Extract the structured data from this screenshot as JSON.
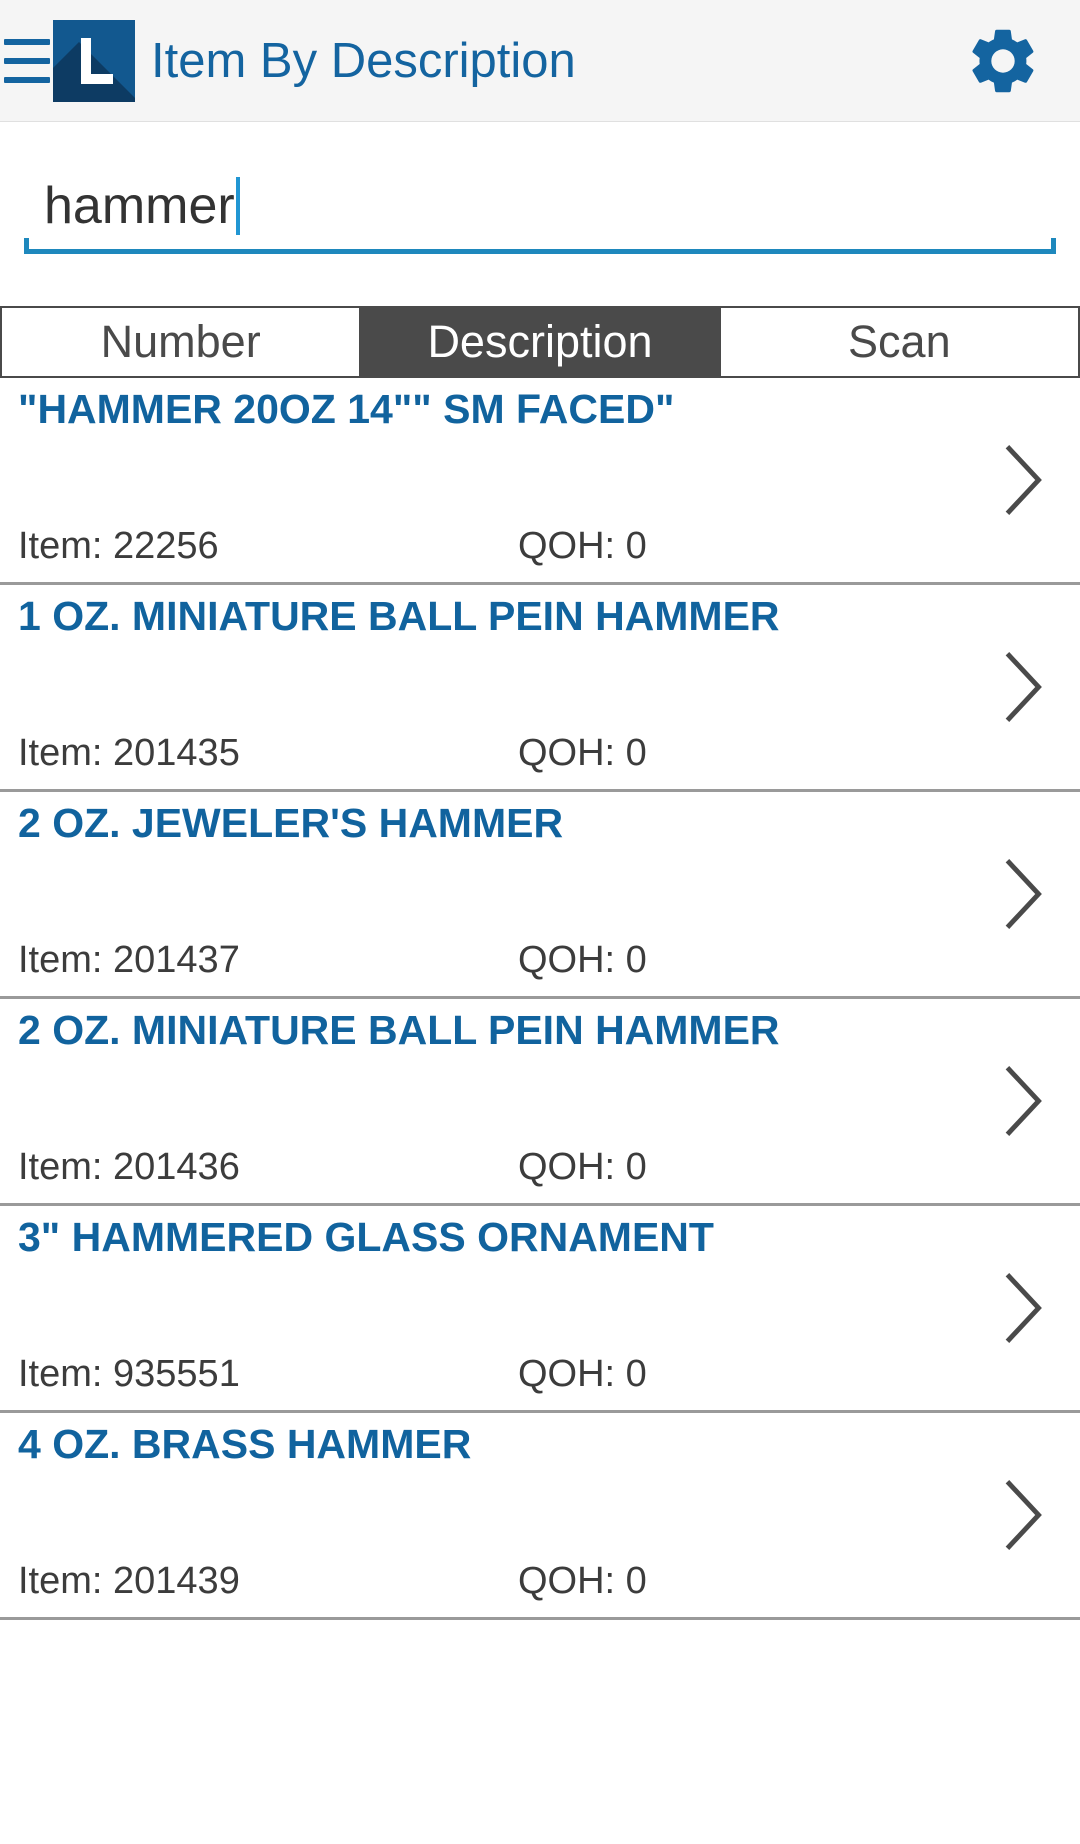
{
  "header": {
    "menu_icon": "hamburger-menu-icon",
    "logo_letter": "L",
    "title": "Item By Description",
    "settings_icon": "gear-icon",
    "accent_color": "#1464a0"
  },
  "search": {
    "value": "hammer",
    "placeholder": ""
  },
  "tabs": [
    {
      "label": "Number",
      "active": false
    },
    {
      "label": "Description",
      "active": true
    },
    {
      "label": "Scan",
      "active": false
    }
  ],
  "list": {
    "item_label": "Item:",
    "qoh_label": "QOH:",
    "chevron_icon": "chevron-right-icon",
    "rows": [
      {
        "title": "\"HAMMER 20OZ  14\"\" SM FACED\"",
        "item": "Item: 22256",
        "qoh": "QOH: 0"
      },
      {
        "title": "1 OZ. MINIATURE BALL PEIN HAMMER",
        "item": "Item: 201435",
        "qoh": "QOH: 0"
      },
      {
        "title": "2 OZ. JEWELER'S HAMMER",
        "item": "Item: 201437",
        "qoh": "QOH: 0"
      },
      {
        "title": "2 OZ. MINIATURE BALL PEIN HAMMER",
        "item": "Item: 201436",
        "qoh": "QOH: 0"
      },
      {
        "title": "3\" HAMMERED GLASS ORNAMENT",
        "item": "Item: 935551",
        "qoh": "QOH: 0"
      },
      {
        "title": "4 OZ. BRASS HAMMER",
        "item": "Item: 201439",
        "qoh": "QOH: 0"
      }
    ]
  }
}
